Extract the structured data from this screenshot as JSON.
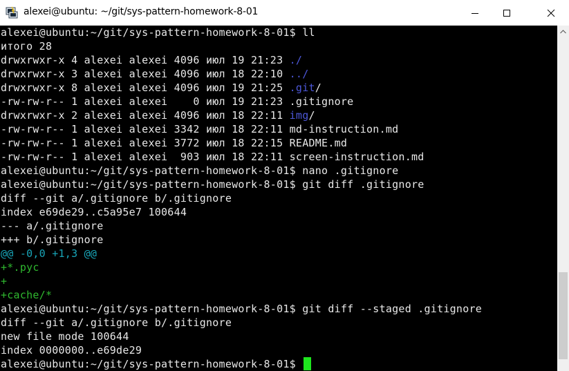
{
  "window": {
    "title": "alexei@ubuntu: ~/git/sys-pattern-homework-8-01",
    "icon": "putty-terminal-icon"
  },
  "colors": {
    "terminal_bg": "#000000",
    "text": "#e8e8e8",
    "directory": "#4c57d8",
    "diff_hunk": "#18a5b8",
    "diff_added": "#2fb82f",
    "cursor": "#1ee61e"
  },
  "terminal": {
    "lines": [
      {
        "text": "alexei@ubuntu:~/git/sys-pattern-homework-8-01$ ll"
      },
      {
        "text": "итого 28"
      },
      {
        "text": "drwxrwxr-x 4 alexei alexei 4096 июл 19 21:23 ",
        "colored": "./",
        "suffix": ""
      },
      {
        "text": "drwxrwxr-x 3 alexei alexei 4096 июл 18 22:10 ",
        "colored": "../",
        "suffix": ""
      },
      {
        "text": "drwxrwxr-x 8 alexei alexei 4096 июл 19 21:25 ",
        "colored": ".git",
        "suffix": "/"
      },
      {
        "text": "-rw-rw-r-- 1 alexei alexei    0 июл 19 21:23 .gitignore"
      },
      {
        "text": "drwxrwxr-x 2 alexei alexei 4096 июл 18 22:11 ",
        "colored": "img",
        "suffix": "/"
      },
      {
        "text": "-rw-rw-r-- 1 alexei alexei 3342 июл 18 22:11 md-instruction.md"
      },
      {
        "text": "-rw-rw-r-- 1 alexei alexei 3772 июл 18 22:15 README.md"
      },
      {
        "text": "-rw-rw-r-- 1 alexei alexei  903 июл 18 22:11 screen-instruction.md"
      },
      {
        "text": "alexei@ubuntu:~/git/sys-pattern-homework-8-01$ nano .gitignore"
      },
      {
        "text": "alexei@ubuntu:~/git/sys-pattern-homework-8-01$ git diff .gitignore"
      },
      {
        "text": "diff --git a/.gitignore b/.gitignore"
      },
      {
        "text": "index e69de29..c5a95e7 100644"
      },
      {
        "text": "--- a/.gitignore"
      },
      {
        "text": "+++ b/.gitignore"
      },
      {
        "text": "@@ -0,0 +1,3 @@"
      },
      {
        "text": "+*.pyc"
      },
      {
        "text": "+"
      },
      {
        "text": "+cache/*"
      },
      {
        "text": "alexei@ubuntu:~/git/sys-pattern-homework-8-01$ git diff --staged .gitignore"
      },
      {
        "text": "diff --git a/.gitignore b/.gitignore"
      },
      {
        "text": "new file mode 100644"
      },
      {
        "text": "index 0000000..e69de29"
      },
      {
        "text": "alexei@ubuntu:~/git/sys-pattern-homework-8-01$ "
      }
    ]
  }
}
